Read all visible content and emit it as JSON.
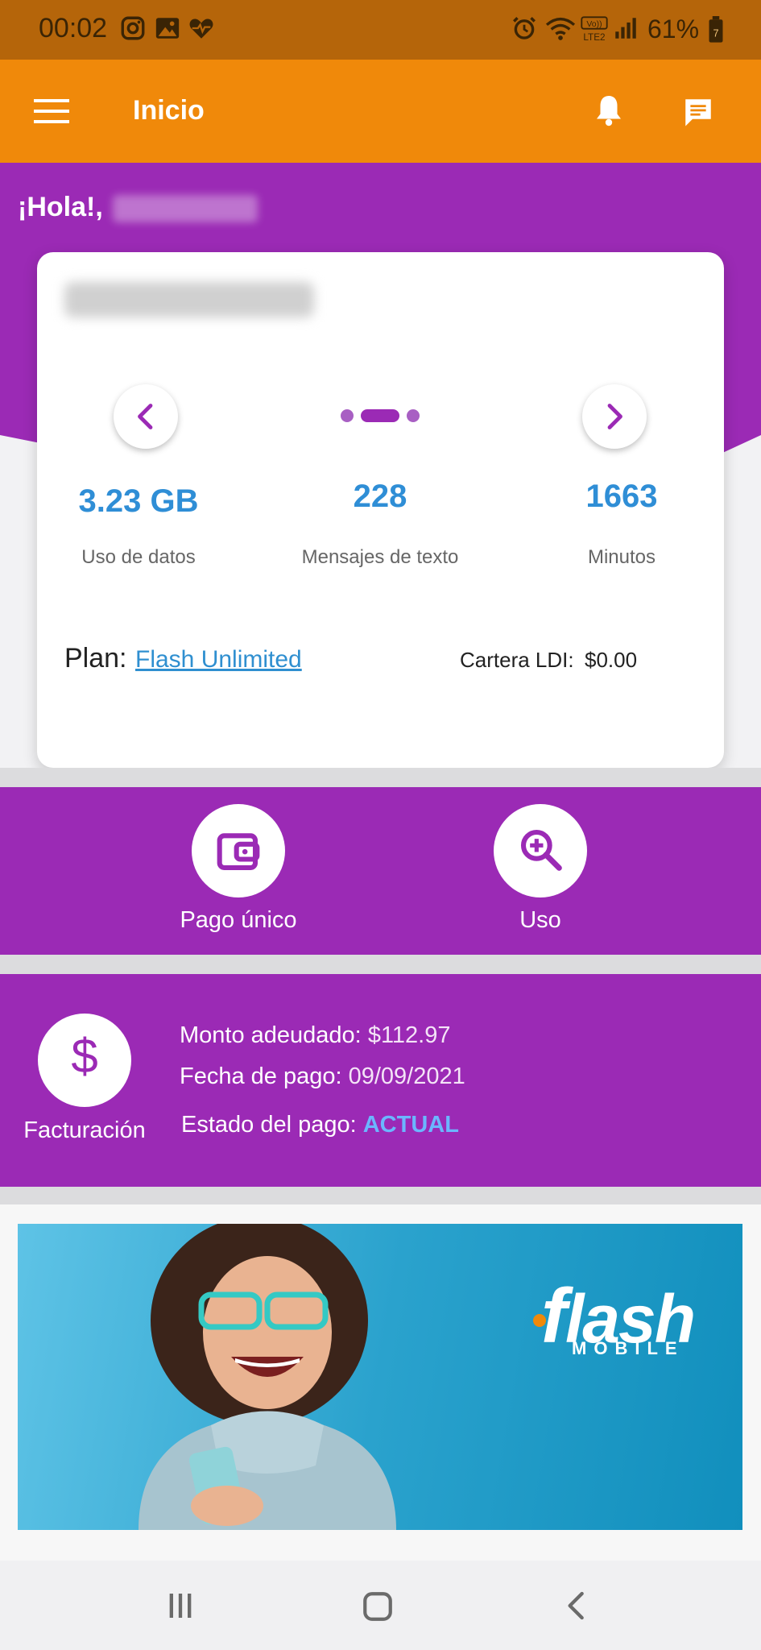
{
  "status_bar": {
    "time": "00:02",
    "battery": "61%",
    "icons": [
      "instagram-icon",
      "gallery-icon",
      "health-icon",
      "alarm-icon",
      "wifi-icon",
      "volte-icon",
      "signal-icon",
      "battery-icon"
    ]
  },
  "app_bar": {
    "title": "Inicio",
    "icons": [
      "menu-icon",
      "bell-icon",
      "chat-icon"
    ]
  },
  "greeting": {
    "prefix": "¡Hola!,"
  },
  "usage": {
    "data_value": "3.23 GB",
    "data_label": "Uso de datos",
    "texts_value": "228",
    "texts_label": "Mensajes de texto",
    "minutes_value": "1663",
    "minutes_label": "Minutos",
    "pager_active_index": 1,
    "pager_count": 3
  },
  "plan": {
    "label": "Plan:",
    "name": "Flash Unlimited",
    "wallet_label": "Cartera LDI:",
    "wallet_value": "$0.00"
  },
  "actions": {
    "payment_label": "Pago único",
    "usage_label": "Uso"
  },
  "billing": {
    "label": "Facturación",
    "amount_label": "Monto adeudado:",
    "amount_value": "$112.97",
    "date_label": "Fecha de pago:",
    "date_value": "09/09/2021",
    "status_label": "Estado del pago:",
    "status_value": "ACTUAL"
  },
  "banner": {
    "logo_text": "lash",
    "logo_sub": "MOBILE"
  },
  "colors": {
    "status_bar": "#b5650a",
    "app_bar": "#f0890a",
    "purple": "#9b2ab5",
    "accent_blue": "#2f8ed6",
    "link_blue": "#2f8fd0",
    "status_actual": "#6bb6ff"
  }
}
